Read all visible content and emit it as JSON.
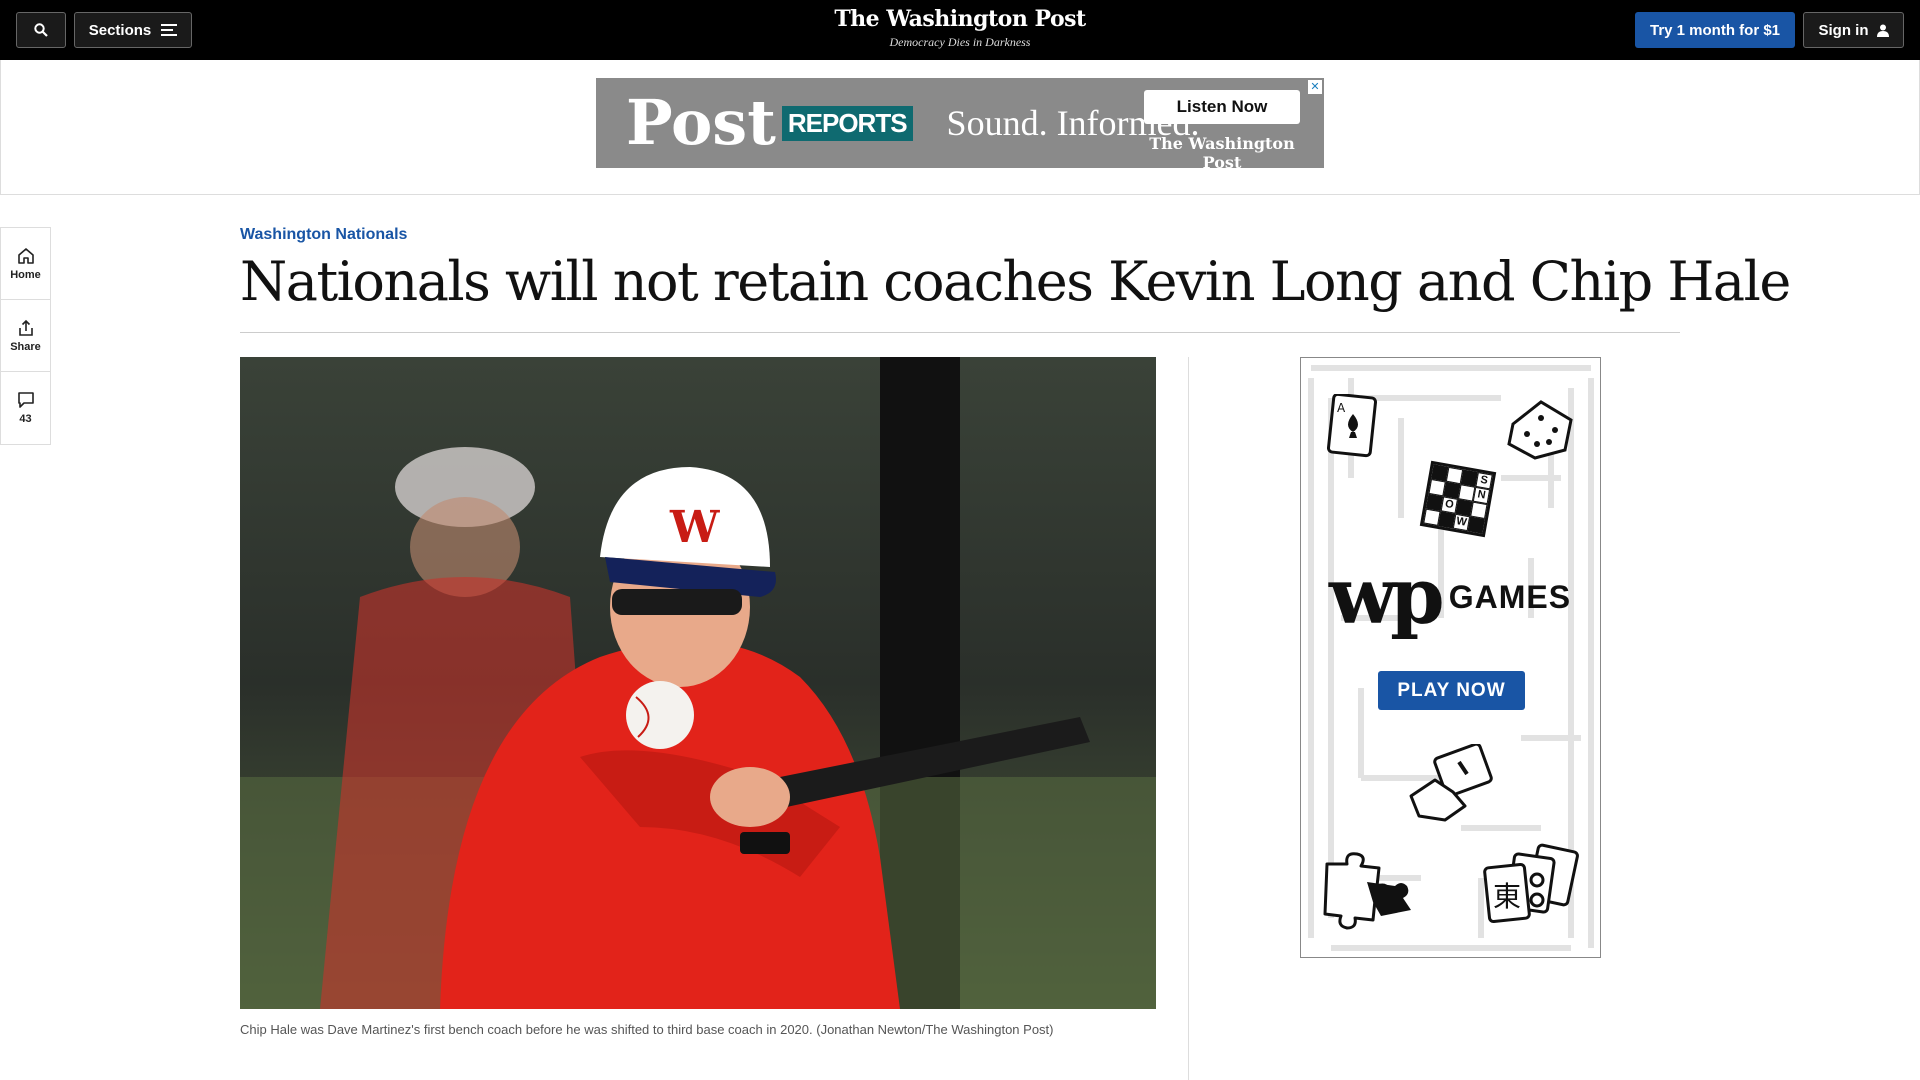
{
  "topbar": {
    "sections_label": "Sections",
    "logo": "The Washington Post",
    "tagline": "Democracy Dies in Darkness",
    "try_label": "Try 1 month for $1",
    "signin_label": "Sign in"
  },
  "top_ad": {
    "post": "Post",
    "reports": "REPORTS",
    "slogan": "Sound. Informed.",
    "cta": "Listen Now",
    "brand": "The Washington Post",
    "close": "✕"
  },
  "rail": {
    "home_label": "Home",
    "share_label": "Share",
    "comments_count": "43"
  },
  "article": {
    "kicker": "Washington Nationals",
    "headline": "Nationals will not retain coaches Kevin Long and Chip Hale",
    "caption": "Chip Hale was Dave Martinez's first bench coach before he was shifted to third base coach in 2020. (Jonathan Newton/The Washington Post)"
  },
  "games_ad": {
    "wp": "wp",
    "games": "GAMES",
    "play": "PLAY NOW",
    "crossword_letters": [
      "S",
      "N",
      "O",
      "W"
    ]
  },
  "colors": {
    "accent_blue": "#1955a5",
    "topbar": "#000000",
    "teal": "#0f6a70"
  }
}
